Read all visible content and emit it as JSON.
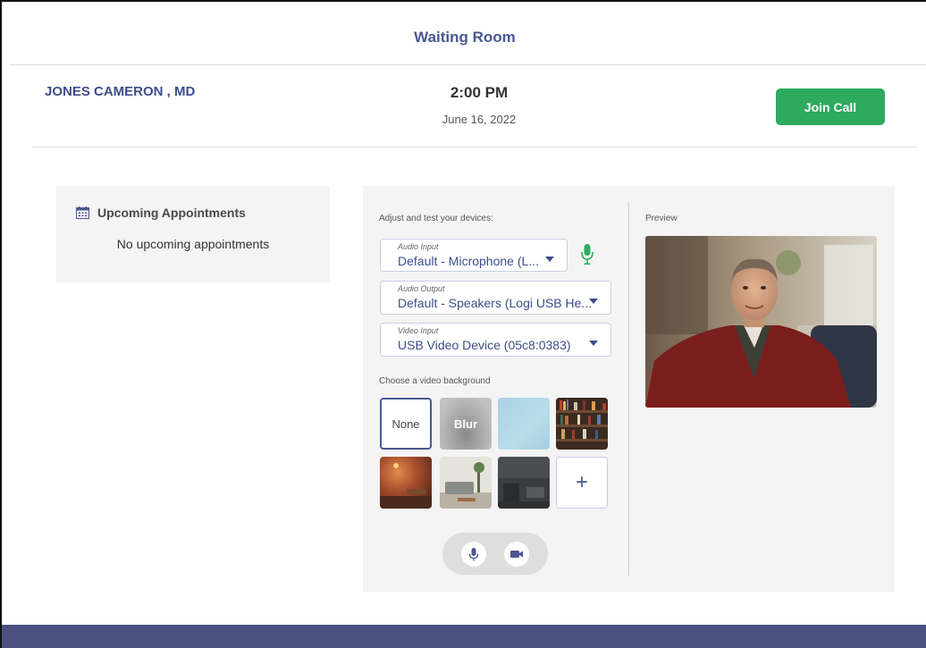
{
  "page": {
    "title": "Waiting Room"
  },
  "header": {
    "provider": "JONES CAMERON , MD",
    "time": "2:00 PM",
    "date": "June 16, 2022",
    "join_label": "Join Call",
    "join_color": "#2daa5e"
  },
  "appointments": {
    "heading": "Upcoming Appointments",
    "empty_text": "No upcoming appointments",
    "icon": "calendar-icon"
  },
  "devices": {
    "heading": "Adjust and test your devices:",
    "audio_input": {
      "label": "Audio Input",
      "value": "Default - Microphone (L..."
    },
    "audio_output": {
      "label": "Audio Output",
      "value": "Default - Speakers (Logi USB He..."
    },
    "video_input": {
      "label": "Video Input",
      "value": "USB Video Device (05c8:0383)"
    },
    "mic_indicator_icon": "microphone-icon",
    "mic_indicator_color": "#2daa5e"
  },
  "backgrounds": {
    "heading": "Choose a video background",
    "none_label": "None",
    "blur_label": "Blur",
    "add_label": "+",
    "items": [
      "none",
      "blur",
      "light-blue",
      "bookshelf",
      "brick-room",
      "living-room",
      "dark-room",
      "add"
    ]
  },
  "preview": {
    "heading": "Preview"
  },
  "controls": {
    "mic_icon": "microphone-icon",
    "camera_icon": "video-camera-icon"
  },
  "theme": {
    "accent": "#4a5791",
    "footer": "#4a5180"
  }
}
